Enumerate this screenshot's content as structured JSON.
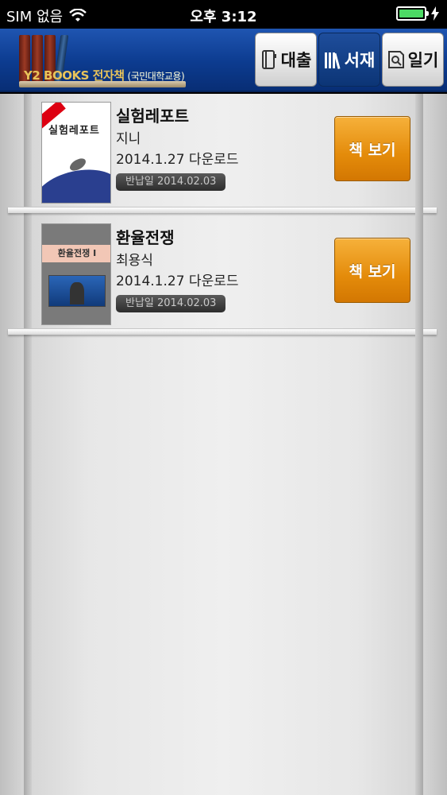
{
  "status_bar": {
    "carrier": "SIM 없음",
    "time": "오후 3:12",
    "battery_level": 1.0
  },
  "header": {
    "logo_text": "Y2 BOOKS 전자책",
    "logo_sub": "(국민대학교용)",
    "tabs": [
      {
        "label": "대출",
        "icon": "book-icon",
        "active": false
      },
      {
        "label": "서재",
        "icon": "bookshelf-icon",
        "active": true
      },
      {
        "label": "일기",
        "icon": "reader-icon",
        "active": false
      }
    ]
  },
  "books": [
    {
      "title": "실험레포트",
      "author": "지니",
      "download_date": "2014.1.27 다운로드",
      "return_label": "반납일 2014.02.03",
      "button": "책 보기",
      "cover_text": "실험레포트"
    },
    {
      "title": "환율전쟁",
      "author": "최용식",
      "download_date": "2014.1.27 다운로드",
      "return_label": "반납일 2014.02.03",
      "button": "책 보기",
      "cover_text": "환율전쟁 I"
    }
  ],
  "colors": {
    "header_blue": "#0c3b8f",
    "button_orange": "#e48b0a",
    "battery_green": "#4cd964"
  }
}
